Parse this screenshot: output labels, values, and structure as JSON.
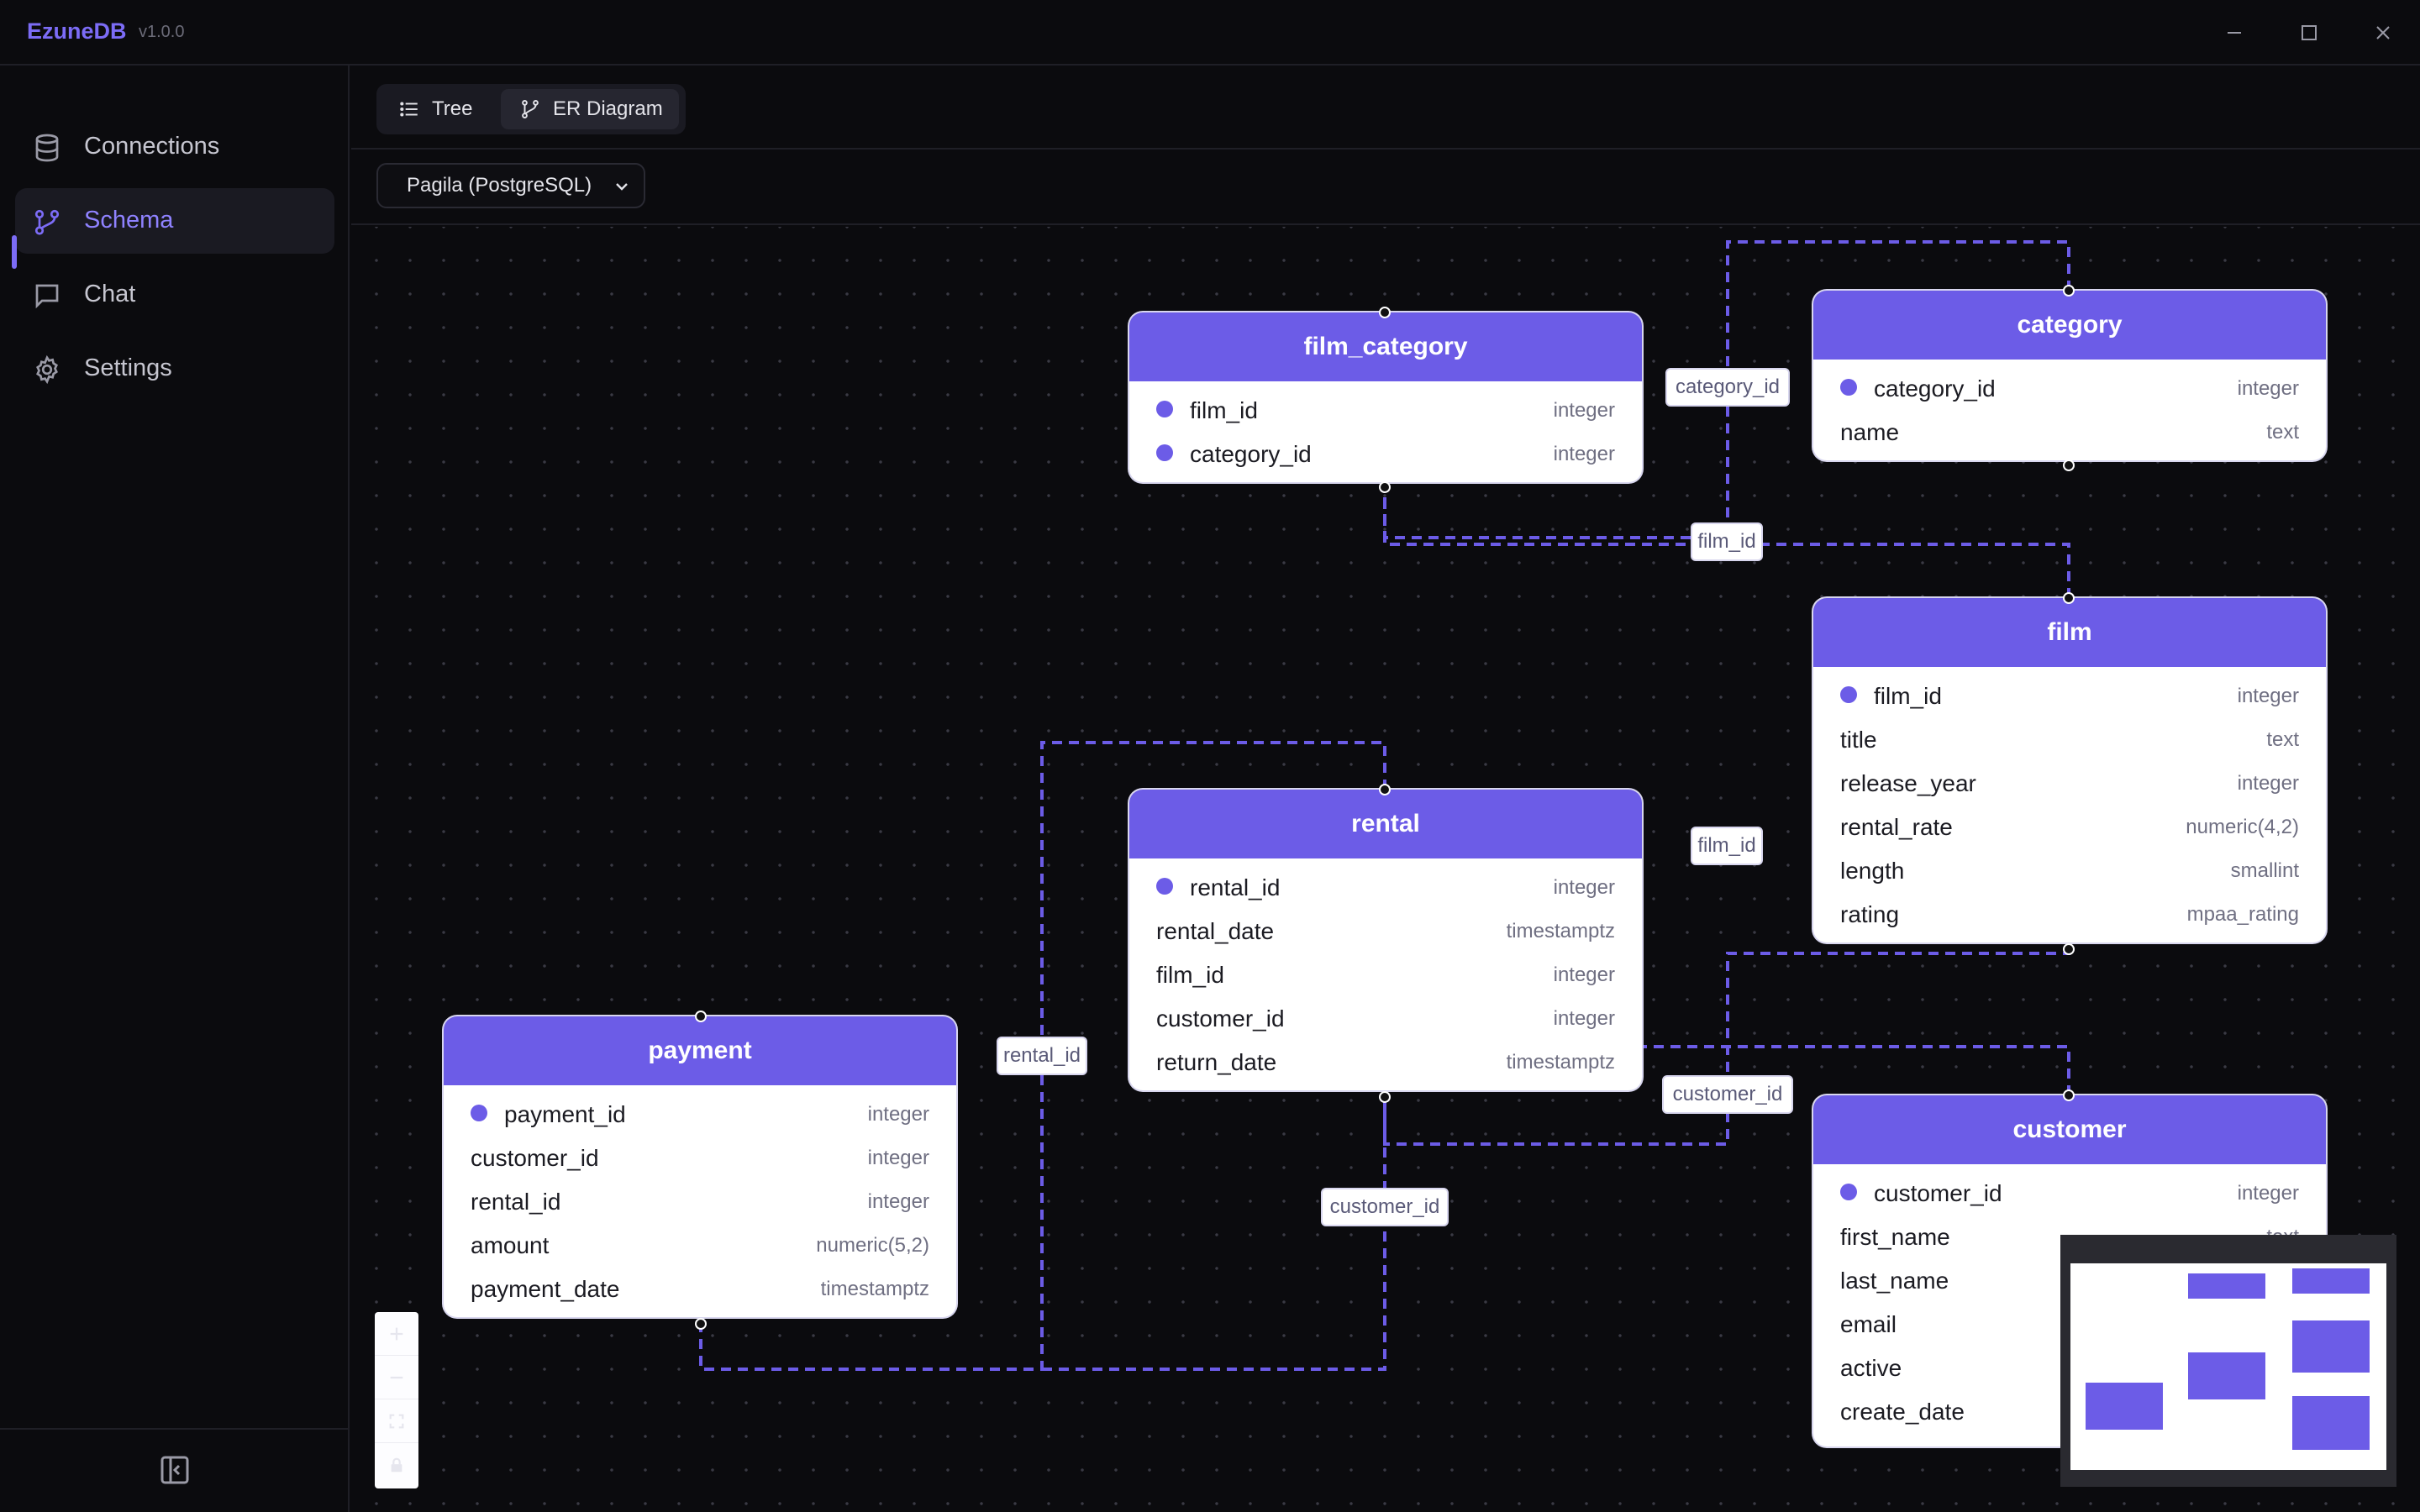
{
  "app": {
    "name": "EzuneDB",
    "version": "v1.0.0"
  },
  "sidebar": {
    "items": [
      {
        "label": "Connections",
        "icon": "database-icon"
      },
      {
        "label": "Schema",
        "icon": "schema-icon",
        "active": true
      },
      {
        "label": "Chat",
        "icon": "chat-icon"
      },
      {
        "label": "Settings",
        "icon": "gear-icon"
      }
    ]
  },
  "view_tabs": [
    {
      "label": "Tree",
      "icon": "list-icon"
    },
    {
      "label": "ER Diagram",
      "icon": "diagram-icon",
      "active": true
    }
  ],
  "database_select": {
    "value": "Pagila (PostgreSQL)"
  },
  "colors": {
    "accent": "#6c5ce7",
    "background": "#0b0b0e",
    "edge": "#6c5ce7"
  },
  "tables": {
    "film_category": {
      "name": "film_category",
      "columns": [
        {
          "name": "film_id",
          "type": "integer",
          "pk": true
        },
        {
          "name": "category_id",
          "type": "integer",
          "pk": true
        }
      ]
    },
    "category": {
      "name": "category",
      "columns": [
        {
          "name": "category_id",
          "type": "integer",
          "pk": true
        },
        {
          "name": "name",
          "type": "text"
        }
      ]
    },
    "film": {
      "name": "film",
      "columns": [
        {
          "name": "film_id",
          "type": "integer",
          "pk": true
        },
        {
          "name": "title",
          "type": "text"
        },
        {
          "name": "release_year",
          "type": "integer"
        },
        {
          "name": "rental_rate",
          "type": "numeric(4,2)"
        },
        {
          "name": "length",
          "type": "smallint"
        },
        {
          "name": "rating",
          "type": "mpaa_rating"
        }
      ]
    },
    "rental": {
      "name": "rental",
      "columns": [
        {
          "name": "rental_id",
          "type": "integer",
          "pk": true
        },
        {
          "name": "rental_date",
          "type": "timestamptz"
        },
        {
          "name": "film_id",
          "type": "integer"
        },
        {
          "name": "customer_id",
          "type": "integer"
        },
        {
          "name": "return_date",
          "type": "timestamptz"
        }
      ]
    },
    "payment": {
      "name": "payment",
      "columns": [
        {
          "name": "payment_id",
          "type": "integer",
          "pk": true
        },
        {
          "name": "customer_id",
          "type": "integer"
        },
        {
          "name": "rental_id",
          "type": "integer"
        },
        {
          "name": "amount",
          "type": "numeric(5,2)"
        },
        {
          "name": "payment_date",
          "type": "timestamptz"
        }
      ]
    },
    "customer": {
      "name": "customer",
      "columns": [
        {
          "name": "customer_id",
          "type": "integer",
          "pk": true
        },
        {
          "name": "first_name",
          "type": "text"
        },
        {
          "name": "last_name",
          "type": ""
        },
        {
          "name": "email",
          "type": ""
        },
        {
          "name": "active",
          "type": ""
        },
        {
          "name": "create_date",
          "type": ""
        }
      ]
    }
  },
  "edge_labels": {
    "category_id": "category_id",
    "film_id_top": "film_id",
    "film_id_mid": "film_id",
    "rental_id": "rental_id",
    "customer_id_right": "customer_id",
    "customer_id_bottom": "customer_id"
  }
}
